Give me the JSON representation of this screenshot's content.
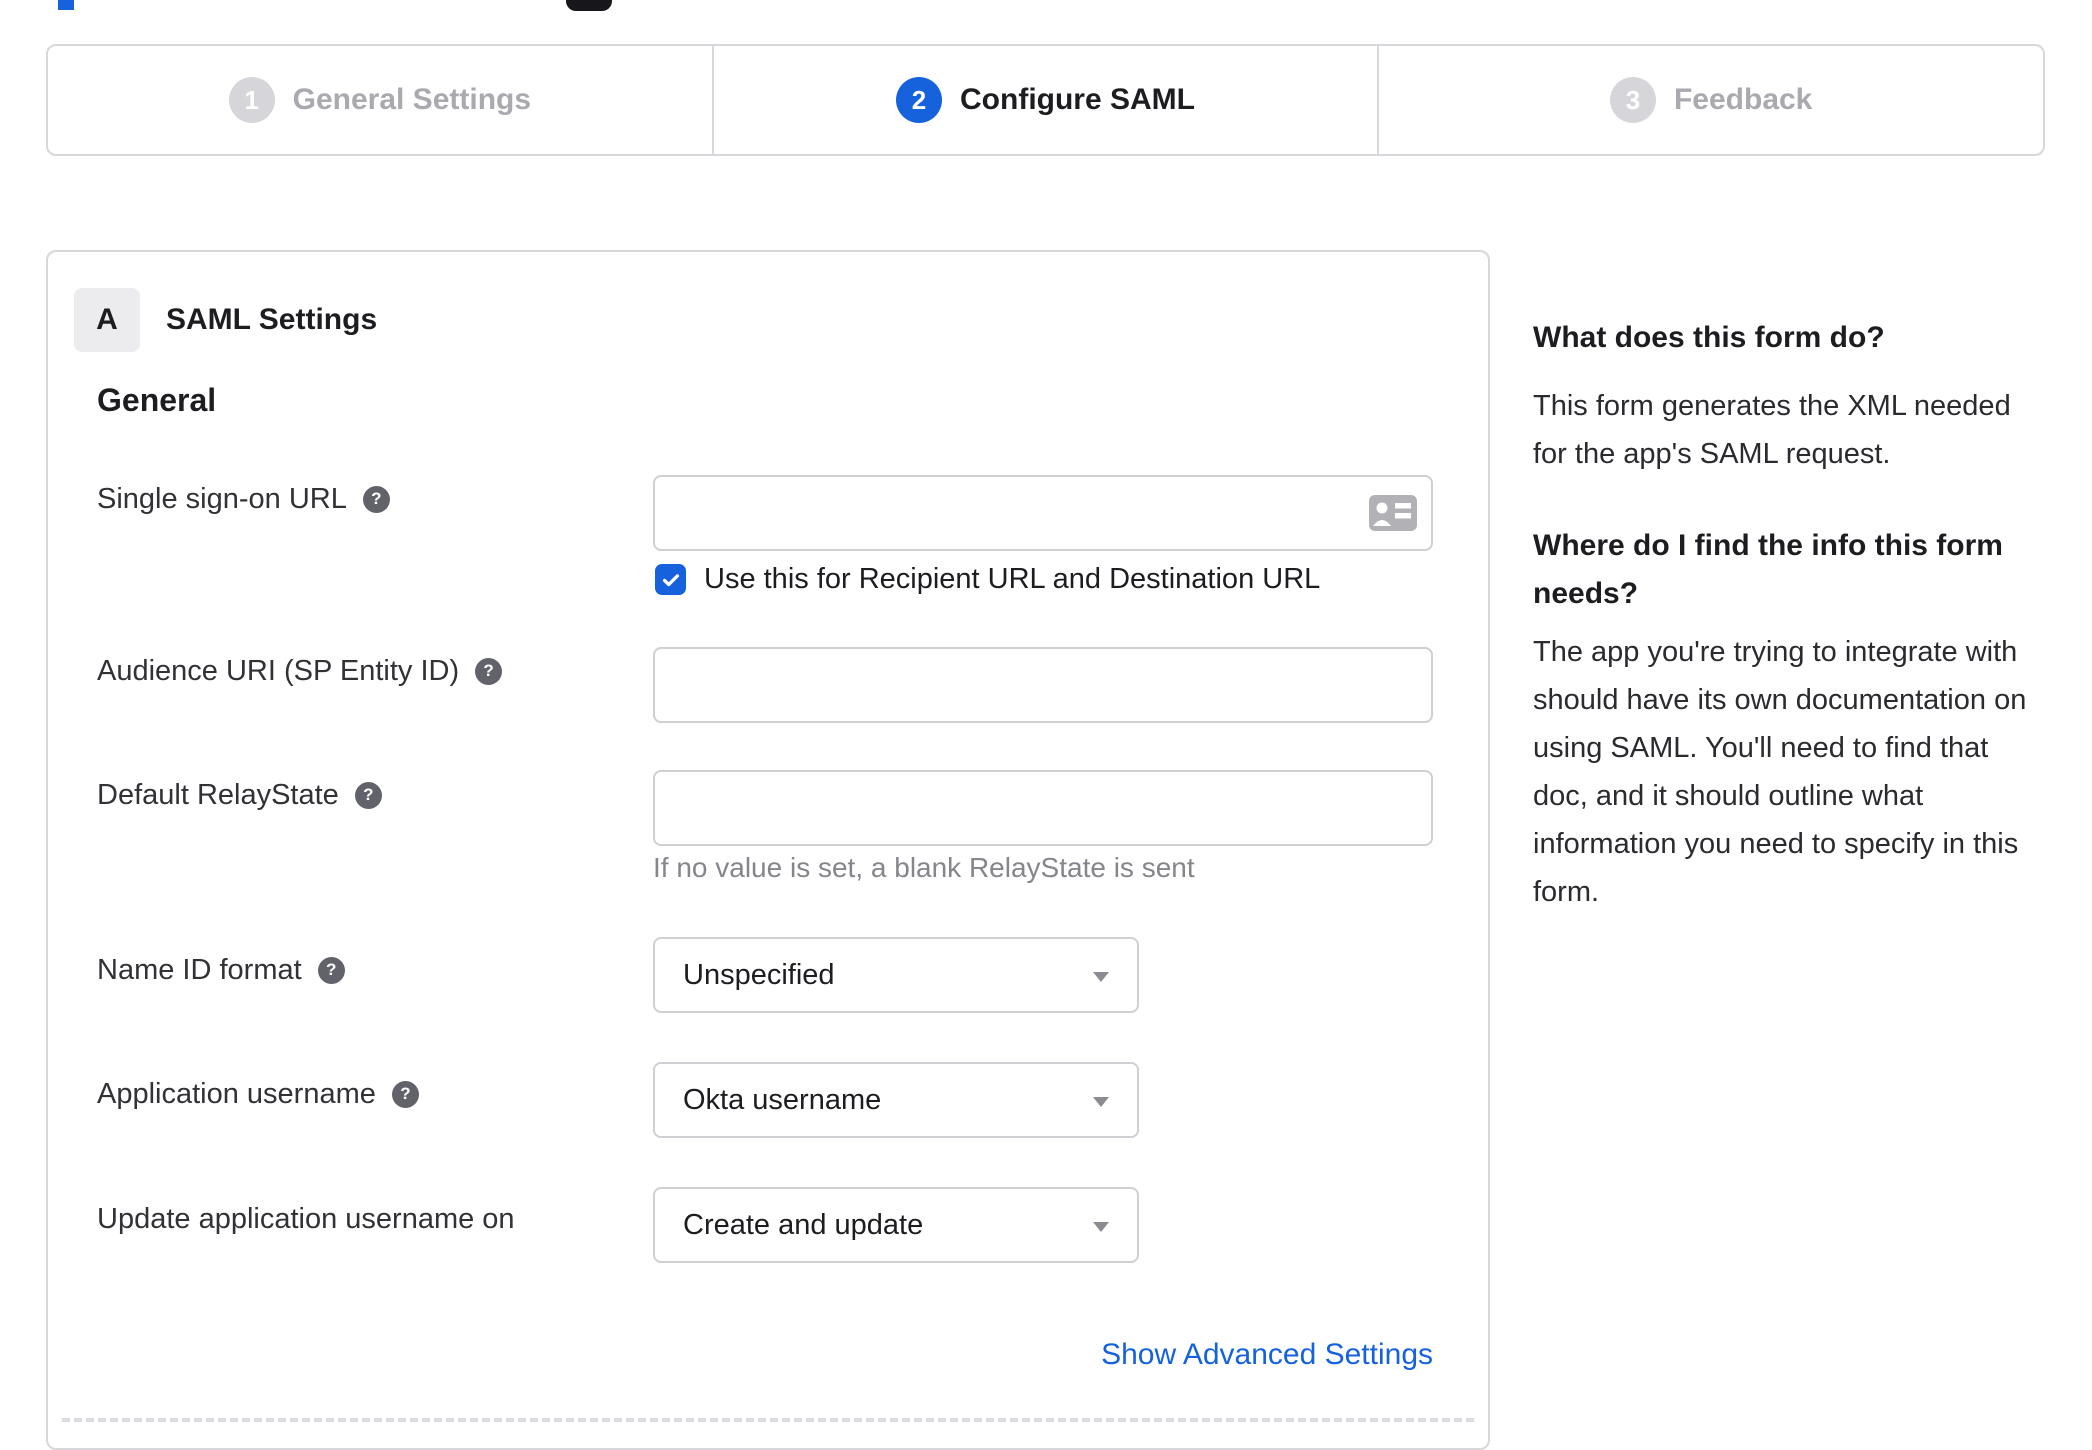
{
  "stepper": {
    "steps": [
      {
        "number": "1",
        "label": "General Settings",
        "state": "inactive"
      },
      {
        "number": "2",
        "label": "Configure SAML",
        "state": "active"
      },
      {
        "number": "3",
        "label": "Feedback",
        "state": "inactive"
      }
    ]
  },
  "panel": {
    "section_badge": "A",
    "section_title": "SAML Settings",
    "group_heading": "General",
    "help_icon_glyph": "?",
    "fields": {
      "sso_url": {
        "label": "Single sign-on URL",
        "value": "",
        "placeholder": ""
      },
      "recipient_checkbox": {
        "label": "Use this for Recipient URL and Destination URL",
        "checked": true
      },
      "audience_uri": {
        "label": "Audience URI (SP Entity ID)",
        "value": "",
        "placeholder": ""
      },
      "default_relay_state": {
        "label": "Default RelayState",
        "value": "",
        "placeholder": "",
        "hint": "If no value is set, a blank RelayState is sent"
      },
      "name_id_format": {
        "label": "Name ID format",
        "value": "Unspecified"
      },
      "application_username": {
        "label": "Application username",
        "value": "Okta username"
      },
      "update_app_username_on": {
        "label": "Update application username on",
        "value": "Create and update"
      }
    },
    "advanced_link": "Show Advanced Settings"
  },
  "sidebar": {
    "blocks": [
      {
        "heading": "What does this form do?",
        "body": "This form generates the XML needed\nfor the app's SAML request."
      },
      {
        "heading": "Where do I find the info this form\nneeds?",
        "body": "The app you're trying to integrate with\nshould have its own documentation on\nusing SAML. You'll need to find that\ndoc, and it should outline what\ninformation you need to specify in this\nform."
      }
    ]
  },
  "colors": {
    "accent_blue": "#1662dd",
    "inactive_step_gray": "#d6d6da",
    "border_gray": "#d8d8dc",
    "hint_gray": "#85858c"
  }
}
